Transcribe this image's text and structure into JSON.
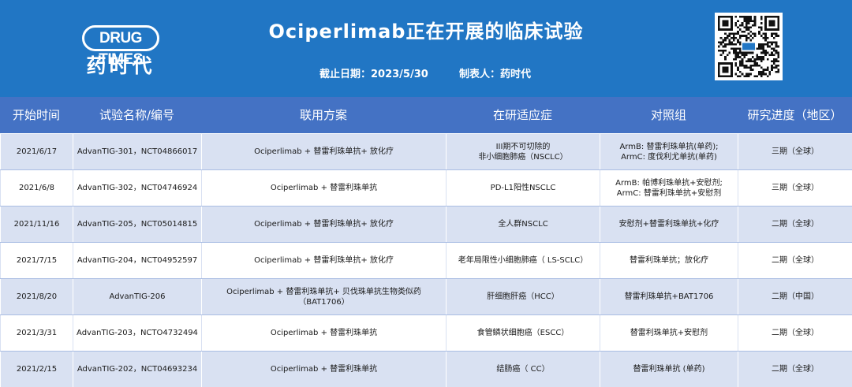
{
  "logo": {
    "en": "DRUG TIMES",
    "cn": "药时代"
  },
  "title": "Ociperlimab正在开展的临床试验",
  "meta": {
    "date": "截止日期：2023/5/30",
    "maker": "制表人：药时代"
  },
  "columns": [
    "开始时间",
    "试验名称/编号",
    "联用方案",
    "在研适应症",
    "对照组",
    "研究进度（地区）"
  ],
  "rows": [
    [
      "2021/6/17",
      "AdvanTIG-301，NCT04866017",
      "Ociperlimab + 替雷利珠单抗+ 放化疗",
      "III期不可切除的\n非小细胞肺癌（NSCLC）",
      "ArmB: 替雷利珠单抗(单药);\nArmC: 度伐利尤单抗(单药)",
      "三期（全球）"
    ],
    [
      "2021/6/8",
      "AdvanTIG-302，NCT04746924",
      "Ociperlimab + 替雷利珠单抗",
      "PD-L1阳性NSCLC",
      "ArmB: 帕博利珠单抗+安慰剂;\nArmC: 替雷利珠单抗+安慰剂",
      "三期（全球）"
    ],
    [
      "2021/11/16",
      "AdvanTIG-205，NCT05014815",
      "Ociperlimab + 替雷利珠单抗+ 放化疗",
      "全人群NSCLC",
      "安慰剂+替雷利珠单抗+化疗",
      "二期（全球）"
    ],
    [
      "2021/7/15",
      "AdvanTIG-204，NCT04952597",
      "Ociperlimab + 替雷利珠单抗+ 放化疗",
      "老年局限性小细胞肺癌（ LS-SCLC）",
      "替雷利珠单抗；放化疗",
      "二期（全球）"
    ],
    [
      "2021/8/20",
      "AdvanTIG-206",
      "Ociperlimab + 替雷利珠单抗+ 贝伐珠单抗生物类似药（BAT1706）",
      "肝细胞肝癌（HCC）",
      "替雷利珠单抗+BAT1706",
      "二期（中国）"
    ],
    [
      "2021/3/31",
      "AdvanTIG-203，NCTO4732494",
      "Ociperlimab + 替雷利珠单抗",
      "食管鳞状细胞癌（ESCC）",
      "替雷利珠单抗+安慰剂",
      "二期（全球）"
    ],
    [
      "2021/2/15",
      "AdvanTIG-202，NCT04693234",
      "Ociperlimab + 替雷利珠单抗",
      "结肠癌（ CC）",
      "替雷利珠单抗 (单药)",
      "二期（全球）"
    ]
  ],
  "colors": {
    "banner": "#2176c4",
    "header": "#4472c4",
    "stripe": "#d9e1f2"
  },
  "icons": {
    "qr": "qr-code-icon"
  }
}
